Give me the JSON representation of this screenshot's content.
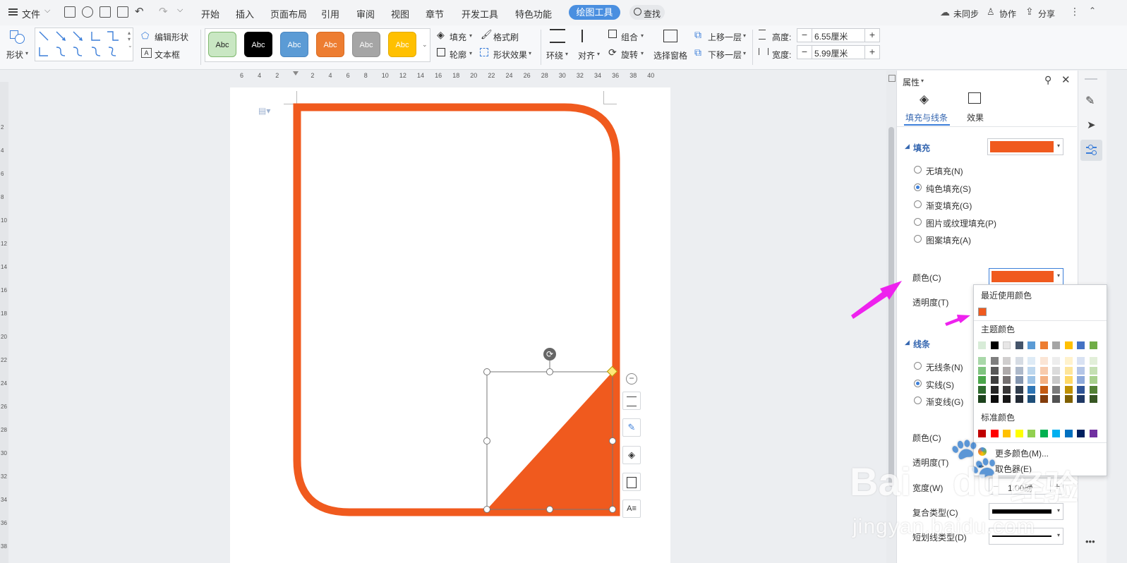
{
  "menubar": {
    "file": "文件",
    "tabs": [
      "开始",
      "插入",
      "页面布局",
      "引用",
      "审阅",
      "视图",
      "章节",
      "开发工具",
      "特色功能"
    ],
    "active_tab": "绘图工具",
    "search": "查找",
    "sync": "未同步",
    "collab": "协作",
    "share": "分享"
  },
  "ribbon": {
    "shape": "形状",
    "edit_shape": "编辑形状",
    "text_box": "文本框",
    "style_swatches": [
      {
        "label": "Abc",
        "bg": "#c9e7c3",
        "fg": "#222222",
        "border": "#7fb86f"
      },
      {
        "label": "Abc",
        "bg": "#000000",
        "fg": "#ffffff",
        "border": "#000000"
      },
      {
        "label": "Abc",
        "bg": "#5b9bd5",
        "fg": "#ffffff",
        "border": "#4a86c0"
      },
      {
        "label": "Abc",
        "bg": "#ed7d31",
        "fg": "#ffffff",
        "border": "#d86a20"
      },
      {
        "label": "Abc",
        "bg": "#a5a5a5",
        "fg": "#ffffff",
        "border": "#909090"
      },
      {
        "label": "Abc",
        "bg": "#ffc000",
        "fg": "#ffffff",
        "border": "#e3ab00"
      }
    ],
    "fill": "填充",
    "format_painter": "格式刷",
    "outline": "轮廓",
    "shape_effect": "形状效果",
    "wrap": "环绕",
    "align": "对齐",
    "group": "组合",
    "rotate": "旋转",
    "selection_pane": "选择窗格",
    "bring_forward": "上移一层",
    "send_backward": "下移一层",
    "height_label": "高度:",
    "height_value": "6.55厘米",
    "width_label": "宽度:",
    "width_value": "5.99厘米"
  },
  "ruler": [
    "6",
    "4",
    "2",
    "",
    "2",
    "4",
    "6",
    "8",
    "10",
    "12",
    "14",
    "16",
    "18",
    "20",
    "22",
    "24",
    "26",
    "28",
    "30",
    "32",
    "34",
    "36",
    "38",
    "40"
  ],
  "ruler_left": [
    "2",
    "4",
    "6",
    "8",
    "10",
    "12",
    "14",
    "16",
    "18",
    "20",
    "22",
    "24",
    "26",
    "28",
    "30",
    "32",
    "34",
    "36",
    "38"
  ],
  "panel": {
    "title": "属性",
    "tab_fill": "填充与线条",
    "tab_effect": "效果",
    "fill_section": "填充",
    "fill_options": [
      "无填充(N)",
      "纯色填充(S)",
      "渐变填充(G)",
      "图片或纹理填充(P)",
      "图案填充(A)"
    ],
    "color_label": "颜色(C)",
    "transparency_label": "透明度(T)",
    "line_section": "线条",
    "line_options": [
      "无线条(N)",
      "实线(S)",
      "渐变线(G)"
    ],
    "line_color_label": "颜色(C)",
    "line_transparency_label": "透明度(T)",
    "width_label": "宽度(W)",
    "width_value": "1.00磅",
    "compound_label": "复合类型(C)",
    "dash_label": "短划线类型(D)",
    "fill_color": "#f05a1e"
  },
  "popup": {
    "recent": "最近使用颜色",
    "theme": "主题颜色",
    "standard": "标准颜色",
    "more": "更多颜色(M)...",
    "eyedropper": "取色器(E)",
    "recent_color": "#f05a1e",
    "theme_top": [
      "#d8ecd8",
      "#000000",
      "#e7e6e6",
      "#44546a",
      "#5b9bd5",
      "#ed7d31",
      "#a5a5a5",
      "#ffc000",
      "#4472c4",
      "#70ad47"
    ],
    "theme_shades": [
      [
        "#a9d8a9",
        "#7f7f7f",
        "#d0cece",
        "#d6dce4",
        "#deebf6",
        "#fbe5d5",
        "#ededed",
        "#fff2cc",
        "#d9e2f3",
        "#e2efd9"
      ],
      [
        "#7fc47f",
        "#595959",
        "#aeaaaa",
        "#adb9ca",
        "#bdd7ee",
        "#f8cbad",
        "#dbdbdb",
        "#fee599",
        "#b4c6e7",
        "#c5e0b3"
      ],
      [
        "#4aa64a",
        "#3f3f3f",
        "#757070",
        "#8496b0",
        "#9dc3e6",
        "#f4b183",
        "#c9c9c9",
        "#ffd966",
        "#8eaadb",
        "#a8d08d"
      ],
      [
        "#2e6b2e",
        "#262626",
        "#3a3838",
        "#323f4f",
        "#2e75b5",
        "#c55a11",
        "#7b7b7b",
        "#bf9000",
        "#2f5496",
        "#538135"
      ],
      [
        "#1c421c",
        "#0c0c0c",
        "#171616",
        "#222a35",
        "#1e4e79",
        "#833c0b",
        "#525252",
        "#7f6000",
        "#1f3864",
        "#375623"
      ]
    ],
    "standard_colors": [
      "#c00000",
      "#ff0000",
      "#ffc000",
      "#ffff00",
      "#92d050",
      "#00b050",
      "#00b0f0",
      "#0070c0",
      "#002060",
      "#7030a0"
    ]
  },
  "shape": {
    "stroke_color": "#f05a1e",
    "triangle_color": "#f05a1e"
  },
  "arrow_color": "#ee22ee",
  "watermark": {
    "line1": "Bai",
    "line2": "du",
    "line3": "经验",
    "url": "jingyan.baidu.com"
  }
}
